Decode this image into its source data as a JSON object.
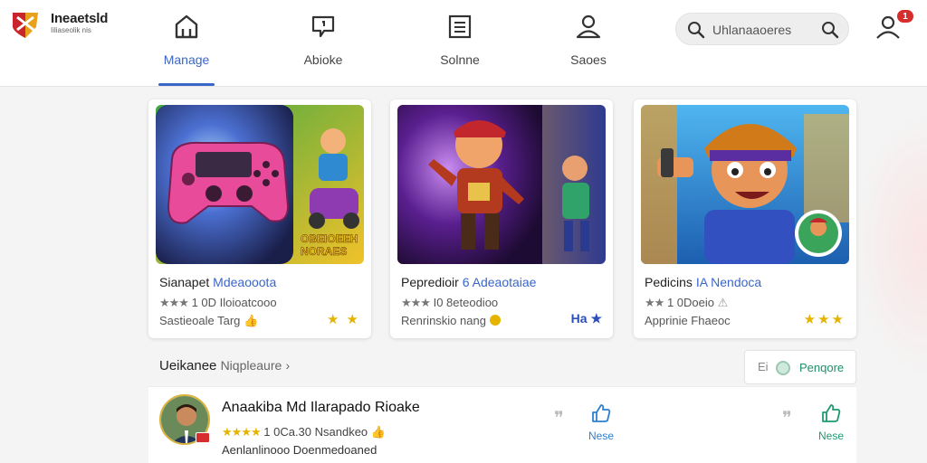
{
  "app": {
    "name": "Ineaetsld",
    "subtitle": "Iiliaseolik nis"
  },
  "nav": {
    "items": [
      {
        "label": "Manage",
        "icon": "house-icon",
        "active": true
      },
      {
        "label": "Abioke",
        "icon": "message-icon",
        "active": false
      },
      {
        "label": "Solnne",
        "icon": "document-icon",
        "active": false
      },
      {
        "label": "Saoes",
        "icon": "user-icon",
        "active": false
      }
    ]
  },
  "search": {
    "placeholder": "Uhlanaaoeres",
    "lead_icon": "search-icon",
    "trail_icon": "search-icon"
  },
  "profile": {
    "icon": "user-icon",
    "badge": "1"
  },
  "cards": [
    {
      "title": "Sianapet",
      "title_accent": "Mdeaooota",
      "stars": "★★★",
      "meta": "1 0D Iloioatcooo",
      "sub": "Sastieoale Targ",
      "sub_icon": "thumb-icon",
      "right": "★ ★",
      "art_text": "OBEIOEEH NORAES"
    },
    {
      "title": "Pepredioir",
      "title_accent": "6 Adeaotaiae",
      "stars": "★★★",
      "meta": "I0 8eteodioo",
      "sub": "Renrinskio nang",
      "sub_icon": "coin-icon",
      "right": "Ha ★"
    },
    {
      "title": "Pedicins",
      "title_accent": "IA Nendoca",
      "stars": "★★",
      "meta": "1 0Doeio",
      "sub": "Apprinie Fhaeoc",
      "sub_icon": "warning-icon",
      "right": "★★★"
    }
  ],
  "section": {
    "title": "Ueikanee",
    "more": "Niqpleaure",
    "filter_icon": "Ei",
    "filter_label": "Penqore"
  },
  "list": [
    {
      "title": "Anaakiba Md Ilarapado Rioake",
      "stars": "★★★★",
      "meta": "1 0Ca.30 Nsandkeo",
      "sub": "Aenlanlinooo Doenmedoaned",
      "like_label_1": "Nese",
      "like_label_2": "Nese",
      "like_color_1": "#2f7fd1",
      "like_color_2": "#1f9a72"
    }
  ],
  "colors": {
    "accent": "#3a66c9",
    "green": "#1f8f6a",
    "badge": "#d62d2d",
    "star": "#e4b400"
  }
}
